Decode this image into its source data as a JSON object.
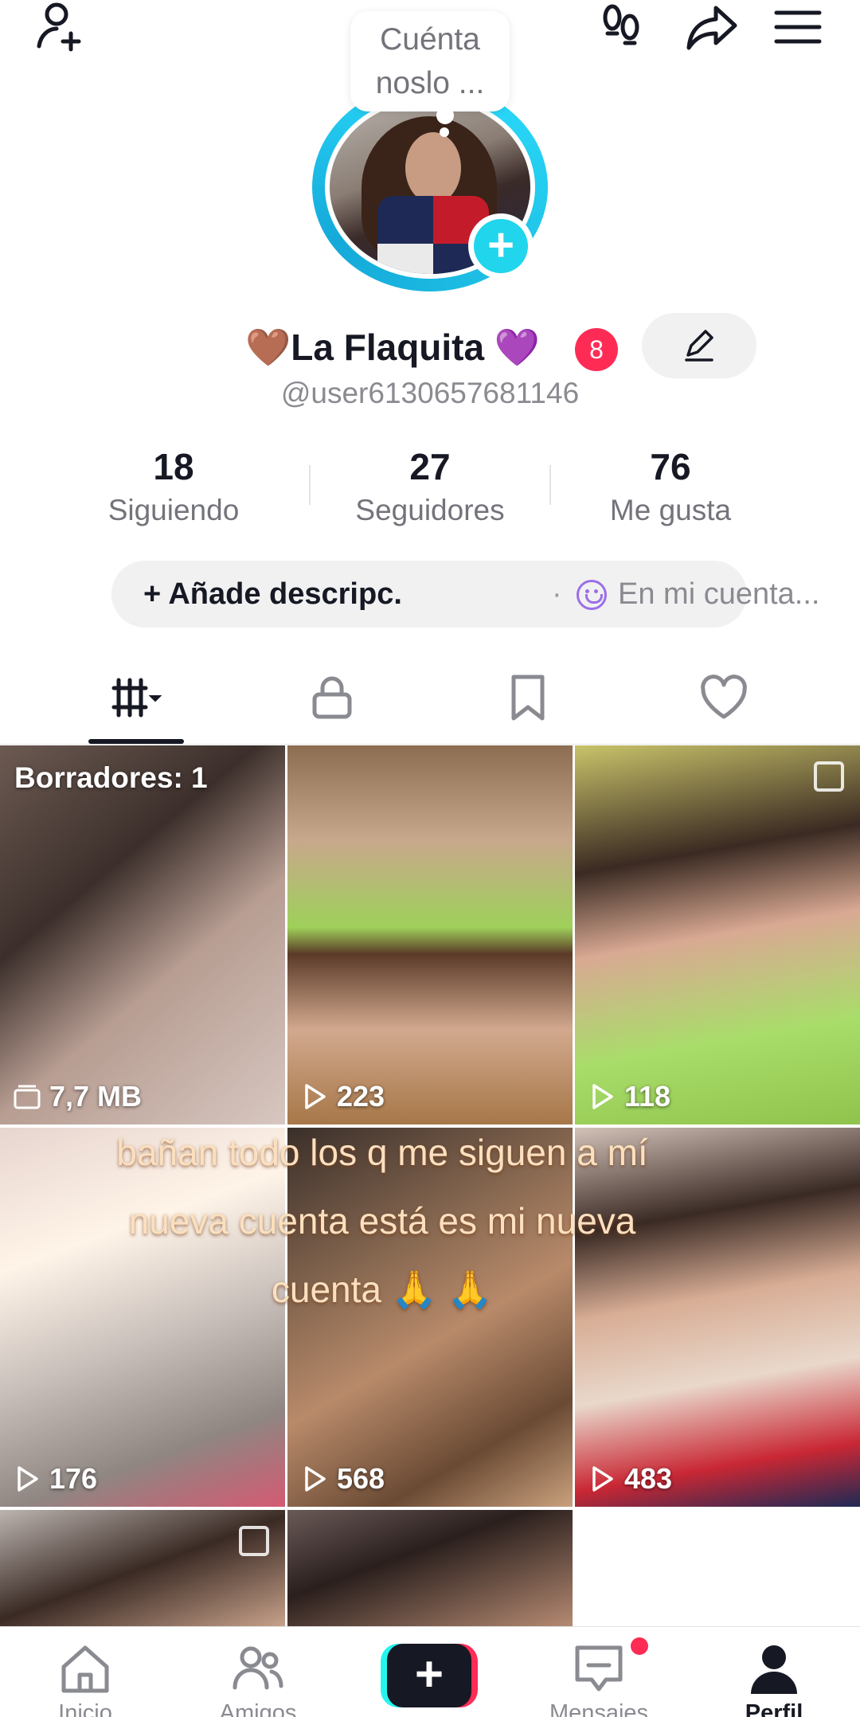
{
  "bubble": {
    "text": "Cuénta noslo ..."
  },
  "profile": {
    "display_name_prefix": "🤎",
    "display_name": "La Flaquita",
    "display_name_suffix": "💜",
    "badge_count": "8",
    "username": "@user6130657681146"
  },
  "stats": [
    {
      "value": "18",
      "label": "Siguiendo"
    },
    {
      "value": "27",
      "label": "Seguidores"
    },
    {
      "value": "76",
      "label": "Me gusta"
    }
  ],
  "bio": {
    "add_label": "+ Añade descripc.",
    "separator": "·",
    "account_label": "En mi cuenta..."
  },
  "tabs": [
    {
      "icon": "grid-icon",
      "active": true
    },
    {
      "icon": "lock-icon"
    },
    {
      "icon": "bookmark-icon"
    },
    {
      "icon": "heart-icon"
    }
  ],
  "videos": [
    {
      "label": "Borradores: 1",
      "info": "7,7 MB",
      "info_icon": "folder-icon"
    },
    {
      "info": "223",
      "info_icon": "play-icon"
    },
    {
      "info": "118",
      "info_icon": "play-icon"
    },
    {
      "info": "176",
      "info_icon": "play-icon"
    },
    {
      "info": "568",
      "info_icon": "play-icon"
    },
    {
      "info": "483",
      "info_icon": "play-icon"
    }
  ],
  "overlay_caption": "bañan todo los q me siguen a mí nueva cuenta está es mi nueva cuenta 🙏 🙏",
  "nav": [
    {
      "label": "Inicio",
      "icon": "home-icon"
    },
    {
      "label": "Amigos",
      "icon": "friends-icon"
    },
    {
      "label": "",
      "icon": "create-icon"
    },
    {
      "label": "Mensajes",
      "icon": "inbox-icon"
    },
    {
      "label": "Perfil",
      "icon": "profile-icon",
      "active": true
    }
  ],
  "colors": {
    "accent_cyan": "#25f4ee",
    "accent_red": "#fe2c55",
    "avatar_ring": "#20d5ec",
    "text_primary": "#161823",
    "text_secondary": "#73747b"
  }
}
